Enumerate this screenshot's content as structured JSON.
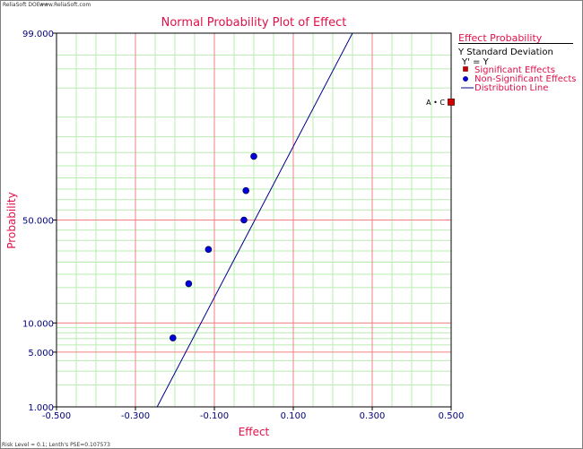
{
  "header": {
    "left_credit": "ReliaSoft DOE++",
    "right_credit": "www.ReliaSoft.com"
  },
  "footer": {
    "status": "Risk Level = 0.1; Lenth's PSE=0.107573"
  },
  "colors": {
    "title": "#e0104a",
    "axis_text": "#000080",
    "grid_major": "#f08080",
    "grid_minor": "#b8ecb0",
    "line": "#00008b",
    "point_fill": "#0000dd",
    "significant": "#cc0000"
  },
  "chart_data": {
    "type": "scatter",
    "title": "Normal Probability Plot of Effect",
    "xlabel": "Effect",
    "ylabel": "Probability",
    "xlim": [
      -0.5,
      0.5
    ],
    "ylim": [
      1,
      99
    ],
    "x_ticks": [
      -0.5,
      -0.3,
      -0.1,
      0.1,
      0.3,
      0.5
    ],
    "x_tick_labels": [
      "-0.500",
      "-0.300",
      "-0.100",
      "0.100",
      "0.300",
      "0.500"
    ],
    "y_ticks": [
      1,
      5,
      10,
      50,
      99
    ],
    "y_tick_labels": [
      "1.000",
      "5.000",
      "10.000",
      "50.000",
      "99.000"
    ],
    "y_scale": "normal-probability",
    "grid": true,
    "non_significant": [
      {
        "x": -0.205,
        "y": 7.1
      },
      {
        "x": -0.165,
        "y": 21.4
      },
      {
        "x": -0.115,
        "y": 35.7
      },
      {
        "x": -0.025,
        "y": 50.0
      },
      {
        "x": -0.02,
        "y": 64.3
      },
      {
        "x": 0.0,
        "y": 78.6
      }
    ],
    "significant": [
      {
        "x": 0.5,
        "y": 92.9,
        "label": "A • C"
      }
    ],
    "distribution_line": {
      "x": [
        -0.245,
        0.25
      ],
      "y": [
        1,
        99
      ]
    },
    "legend": {
      "position": "right",
      "title": "Effect Probability",
      "subtitle1": "Y Standard Deviation",
      "subtitle2": "Y' = Y",
      "items": [
        "Significant Effects",
        "Non-Significant Effects",
        "Distribution Line"
      ]
    }
  }
}
